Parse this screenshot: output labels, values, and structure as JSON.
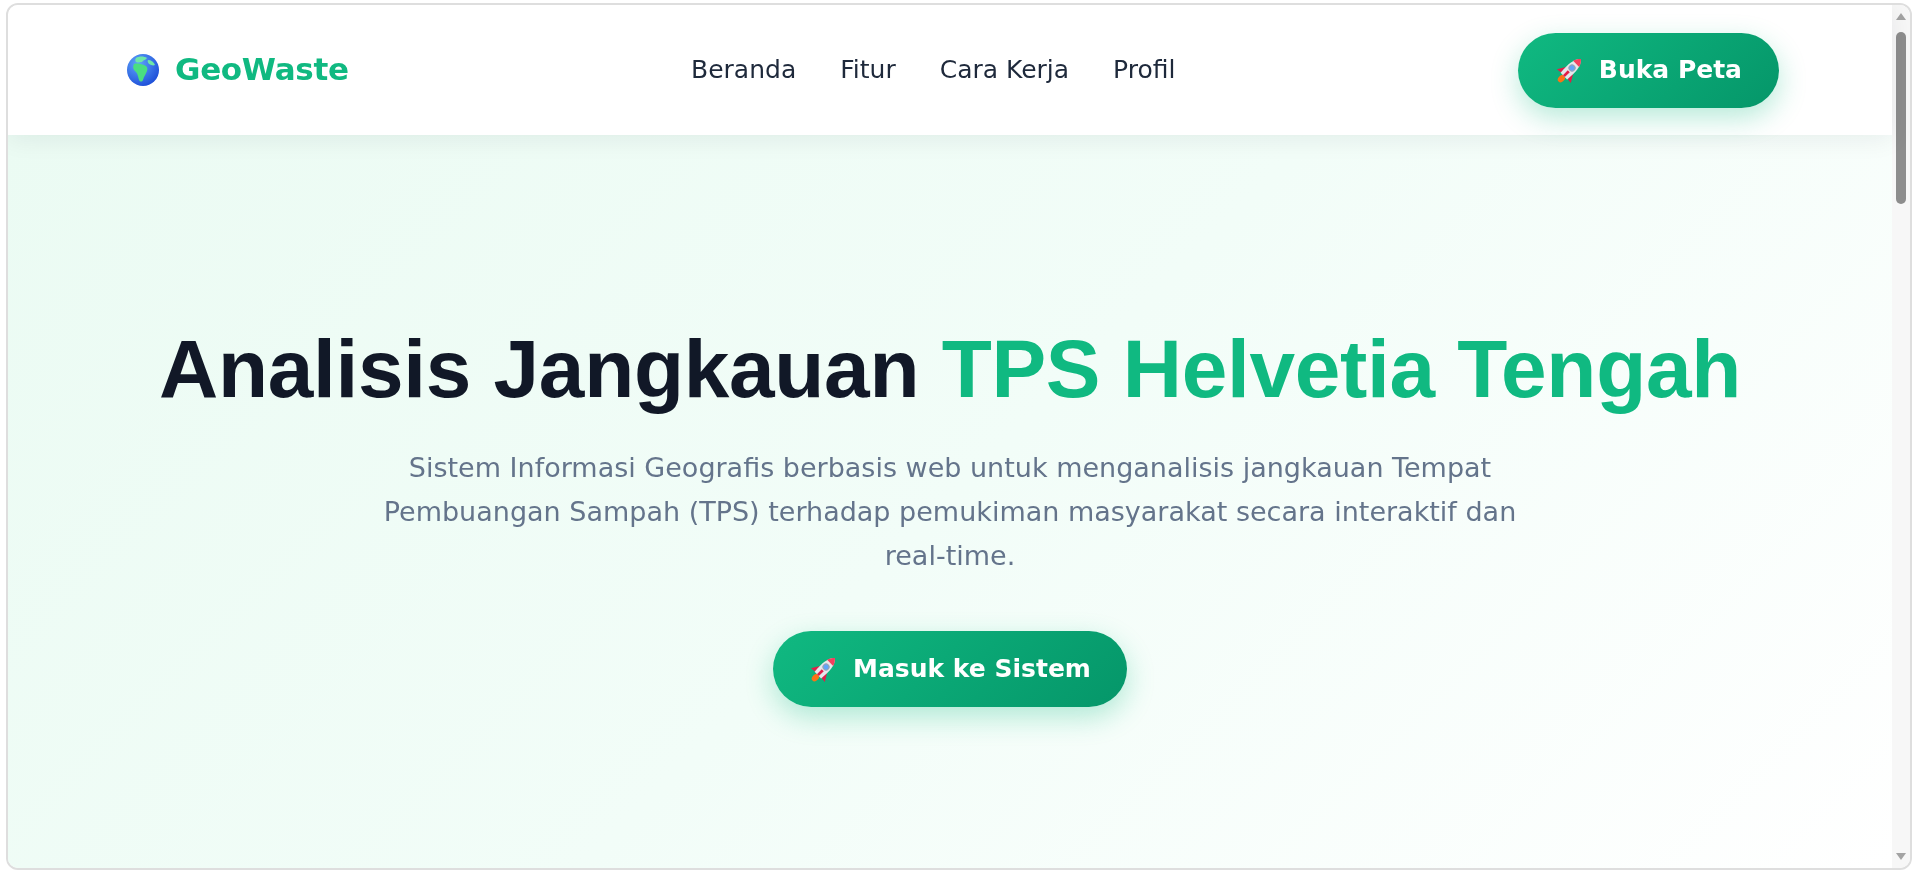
{
  "brand": {
    "name": "GeoWaste"
  },
  "nav": {
    "links": [
      {
        "label": "Beranda"
      },
      {
        "label": "Fitur"
      },
      {
        "label": "Cara Kerja"
      },
      {
        "label": "Profil"
      }
    ],
    "cta": {
      "label": "Buka Peta"
    }
  },
  "hero": {
    "title_parts": [
      {
        "text": "Analisis Jangkauan",
        "accent": false
      },
      {
        "text": "TPS Helvetia Tengah",
        "accent": true
      }
    ],
    "subtitle": "Sistem Informasi Geografis berbasis web untuk menganalisis jangkauan Tempat Pembuangan Sampah (TPS) terhadap pemukiman masyarakat secara interaktif dan real-time.",
    "button": {
      "label": "Masuk ke Sistem"
    }
  }
}
